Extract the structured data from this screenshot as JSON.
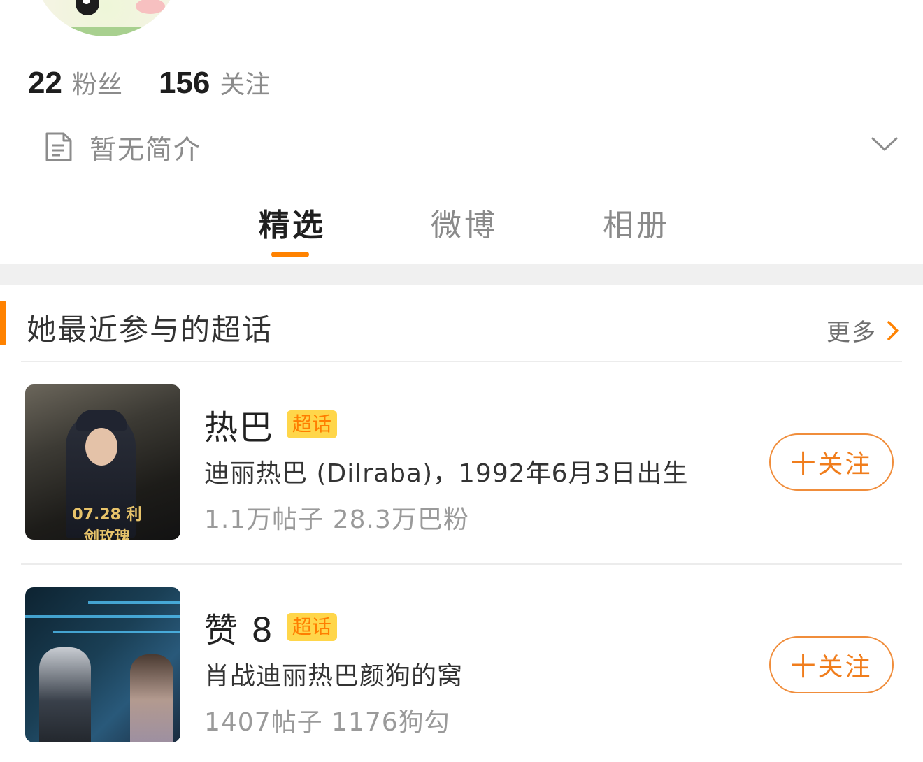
{
  "profile": {
    "stats": [
      {
        "value": "22",
        "label": "粉丝"
      },
      {
        "value": "156",
        "label": "关注"
      }
    ],
    "bio": "暂无简介"
  },
  "tabs": [
    {
      "label": "精选",
      "active": true
    },
    {
      "label": "微博",
      "active": false
    },
    {
      "label": "相册",
      "active": false
    }
  ],
  "section": {
    "title": "她最近参与的超话",
    "more_label": "更多"
  },
  "topics": [
    {
      "name": "热巴",
      "badge": "超话",
      "description": "迪丽热巴 (Dilraba)，1992年6月3日出生",
      "stats": "1.1万帖子 28.3万巴粉",
      "thumb_text": "07.28 利剑玫瑰",
      "follow_label": "十关注"
    },
    {
      "name": "赞 8",
      "badge": "超话",
      "description": "肖战迪丽热巴颜狗的窝",
      "stats": "1407帖子 1176狗勾",
      "follow_label": "十关注"
    }
  ],
  "colors": {
    "accent": "#ff8200",
    "badge_bg": "#ffd64a",
    "badge_text": "#ff7e00",
    "follow_border": "#f08d3b"
  }
}
